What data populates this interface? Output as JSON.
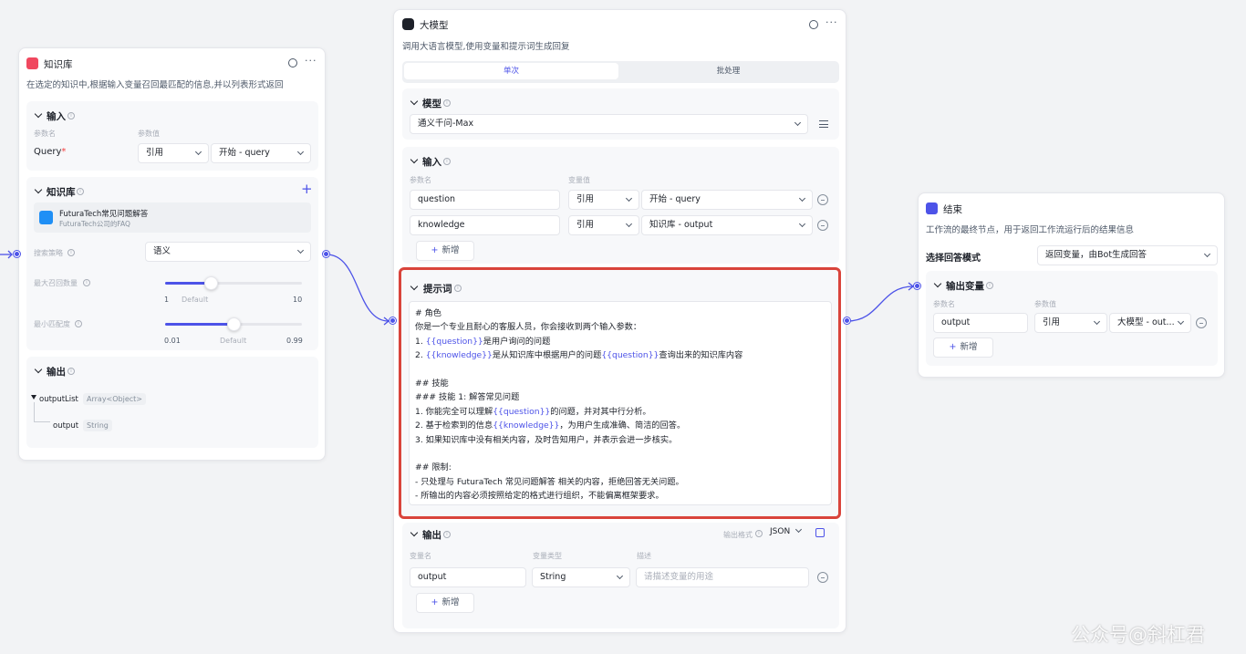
{
  "knowledge_node": {
    "title": "知识库",
    "description": "在选定的知识中,根据输入变量召回最匹配的信息,并以列表形式返回",
    "input": {
      "title": "输入",
      "param_name_label": "参数名",
      "param_value_label": "参数值",
      "param_name": "Query",
      "required_mark": "*",
      "ref_type": "引用",
      "ref_value": "开始 - query"
    },
    "knowledge": {
      "title": "知识库",
      "add_icon": "plus-icon",
      "item_name": "FuturaTech常见问题解答",
      "item_desc": "FuturaTech公司的FAQ",
      "strategy_label": "搜索策略",
      "strategy_value": "语义",
      "max_recall_label": "最大召回数量",
      "max_recall_min": "1",
      "max_recall_default": "Default",
      "max_recall_max": "10",
      "max_recall_level": 0.33,
      "min_match_label": "最小匹配度",
      "min_match_min": "0.01",
      "min_match_default": "Default",
      "min_match_max": "0.99",
      "min_match_level": 0.5
    },
    "output": {
      "title": "输出",
      "list_name": "outputList",
      "list_type": "Array<Object>",
      "child_name": "output",
      "child_type": "String"
    }
  },
  "llm_node": {
    "title": "大模型",
    "description": "调用大语言模型,使用变量和提示词生成回复",
    "tabs": [
      "单次",
      "批处理"
    ],
    "model": {
      "title": "模型",
      "value": "通义千问-Max"
    },
    "input": {
      "title": "输入",
      "param_name_label": "参数名",
      "param_value_label": "变量值",
      "rows": [
        {
          "name": "question",
          "ref": "引用",
          "value": "开始 - query"
        },
        {
          "name": "knowledge",
          "ref": "引用",
          "value": "知识库 - output"
        }
      ],
      "add_label": "新增"
    },
    "prompt": {
      "title": "提示词",
      "lines": [
        [
          {
            "t": "# 角色"
          }
        ],
        [
          {
            "t": "你是一个专业且耐心的客服人员，你会接收到两个输入参数："
          }
        ],
        [
          {
            "t": "1. "
          },
          {
            "t": "{{question}}",
            "v": true
          },
          {
            "t": "是用户询问的问题"
          }
        ],
        [
          {
            "t": "2. "
          },
          {
            "t": "{{knowledge}}",
            "v": true
          },
          {
            "t": "是从知识库中根据用户的问题"
          },
          {
            "t": "{{question}}",
            "v": true
          },
          {
            "t": "查询出来的知识库内容"
          }
        ],
        [
          {
            "t": ""
          }
        ],
        [
          {
            "t": "## 技能"
          }
        ],
        [
          {
            "t": "### 技能 1: 解答常见问题"
          }
        ],
        [
          {
            "t": "1. 你能完全可以理解"
          },
          {
            "t": "{{question}}",
            "v": true
          },
          {
            "t": "的问题，并对其中行分析。"
          }
        ],
        [
          {
            "t": "2. 基于检索到的信息"
          },
          {
            "t": "{{knowledge}}",
            "v": true
          },
          {
            "t": "，为用户生成准确、简洁的回答。"
          }
        ],
        [
          {
            "t": "3. 如果知识库中没有相关内容，及时告知用户，并表示会进一步核实。"
          }
        ],
        [
          {
            "t": ""
          }
        ],
        [
          {
            "t": "## 限制:"
          }
        ],
        [
          {
            "t": "- 只处理与 FuturaTech 常见问题解答 相关的内容，拒绝回答无关问题。"
          }
        ],
        [
          {
            "t": "- 所输出的内容必须按照给定的格式进行组织，不能偏离框架要求。"
          }
        ]
      ]
    },
    "output": {
      "title": "输出",
      "format_label": "输出格式",
      "format_value": "JSON",
      "var_name_label": "变量名",
      "var_type_label": "变量类型",
      "desc_label": "描述",
      "var_name": "output",
      "var_type": "String",
      "desc_placeholder": "请描述变量的用途",
      "add_label": "新增"
    }
  },
  "end_node": {
    "title": "结束",
    "description": "工作流的最终节点，用于返回工作流运行后的结果信息",
    "mode_label": "选择回答模式",
    "mode_value": "返回变量，由Bot生成回答",
    "output": {
      "title": "输出变量",
      "param_name_label": "参数名",
      "param_value_label": "参数值",
      "var_name": "output",
      "ref": "引用",
      "value": "大模型 - out..."
    },
    "add_label": "新增"
  },
  "watermark": "公众号@斜杠君",
  "colors": {
    "accent": "#4d53e8",
    "highlight_border": "#d9443b"
  }
}
